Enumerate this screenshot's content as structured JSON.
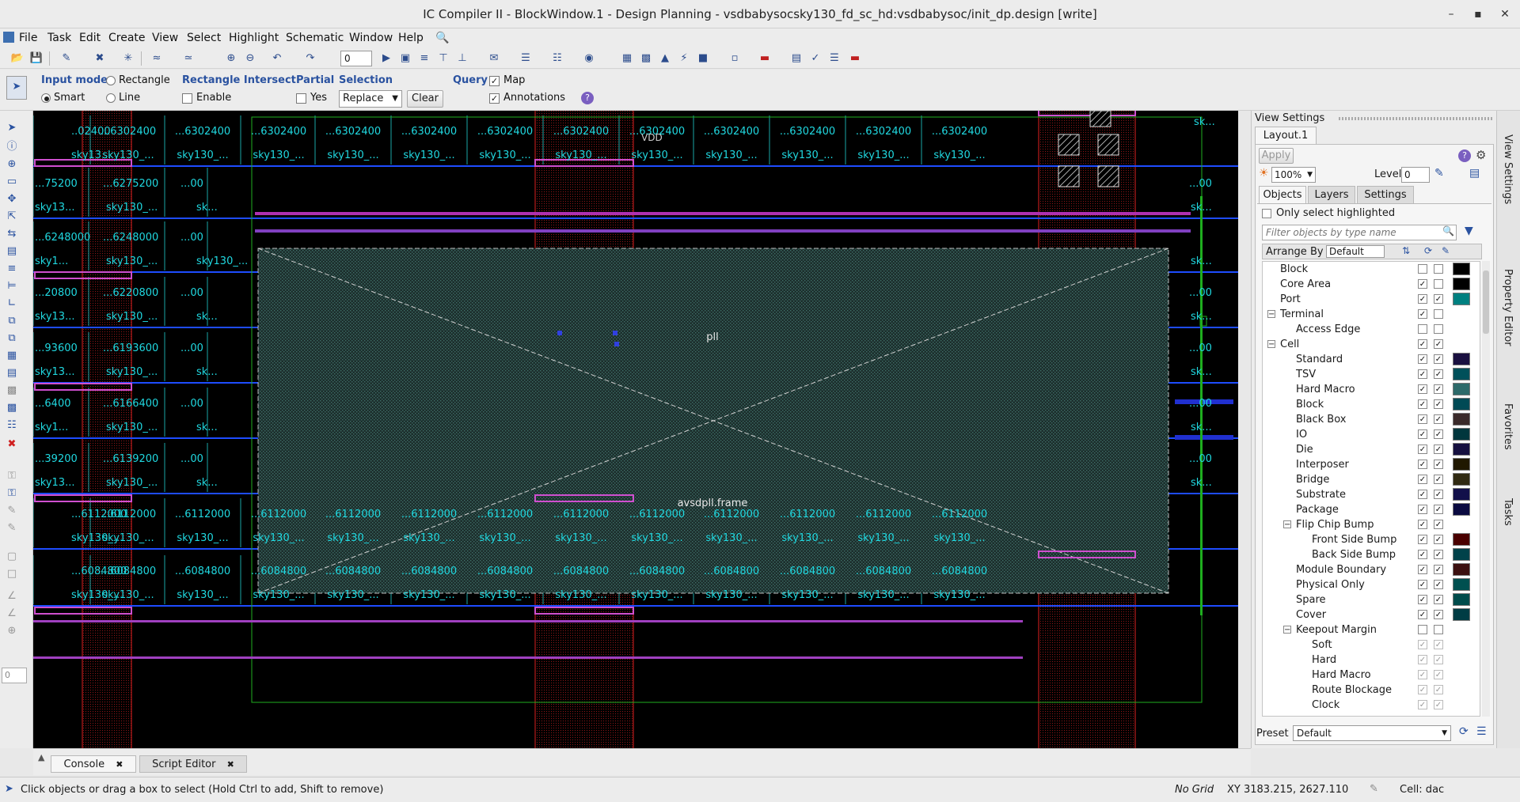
{
  "window": {
    "title": "IC Compiler II - BlockWindow.1 - Design Planning - vsdbabysocsky130_fd_sc_hd:vsdbabysoc/init_dp.design [write]",
    "minimize": "–",
    "maximize": "▪",
    "close": "✕"
  },
  "menubar": [
    "File",
    "Task",
    "Edit",
    "Create",
    "View",
    "Select",
    "Highlight",
    "Schematic",
    "Window",
    "Help"
  ],
  "toolbar": {
    "level_value": "0"
  },
  "select_options": {
    "input_mode_label": "Input mode",
    "rectangle_label": "Rectangle",
    "smart_label": "Smart",
    "line_label": "Line",
    "rect_intersect_label": "Rectangle Intersect",
    "enable_label": "Enable",
    "partial_label": "Partial",
    "yes_label": "Yes",
    "selection_label": "Selection",
    "replace_value": "Replace",
    "clear_label": "Clear",
    "query_label": "Query",
    "map_label": "Map",
    "annotations_label": "Annotations"
  },
  "canvas": {
    "macro_top_label": "pll",
    "macro_bottom_label": "avsdpll.frame",
    "vdd_label": "VDD",
    "rows": [
      {
        "coord": [
          "..02400",
          "...6302400",
          "...6302400",
          "...6302400",
          "...6302400",
          "...6302400",
          "...6302400",
          "...6302400",
          "...6302400",
          "...6302400",
          "...6302400",
          "...6302400",
          "...6302400"
        ],
        "cell": [
          "sky13...",
          "sky130_...",
          "sky130_...",
          "sky130_...",
          "sky130_...",
          "sky130_...",
          "sky130_...",
          "sky130_...",
          "sky130_...",
          "sky130_...",
          "sky130_...",
          "sky130_...",
          "sky130_..."
        ]
      },
      {
        "coord": [
          "...75200",
          "...6275200",
          "...00",
          "...00"
        ],
        "cell": [
          "sky13...",
          "sky130_...",
          "sk...",
          "sk..."
        ]
      },
      {
        "coord": [
          "...6248000",
          "...6248000",
          "...00"
        ],
        "cell": [
          "sky1...",
          "sky130_...",
          "sky130_...",
          "sk..."
        ]
      },
      {
        "coord": [
          "...20800",
          "...6220800",
          "...00",
          "...00"
        ],
        "cell": [
          "sky13...",
          "sky130_...",
          "sk...",
          "sk..."
        ]
      },
      {
        "coord": [
          "...93600",
          "...6193600",
          "...00",
          "...00"
        ],
        "cell": [
          "sky13...",
          "sky130_...",
          "sk...",
          "sk..."
        ]
      },
      {
        "coord": [
          "...6400",
          "...6166400",
          "...00",
          "...00"
        ],
        "cell": [
          "sky1...",
          "sky130_...",
          "sk...",
          "sk..."
        ]
      },
      {
        "coord": [
          "...39200",
          "...6139200",
          "...00",
          "...00"
        ],
        "cell": [
          "sky13...",
          "sky130_...",
          "sk...",
          "sk..."
        ]
      },
      {
        "coord": [
          "...6112000",
          "...6112000",
          "...6112000",
          "...6112000",
          "...6112000",
          "...6112000",
          "...6112000",
          "...6112000",
          "...6112000",
          "...6112000",
          "...6112000",
          "...6112000",
          "...6112000"
        ],
        "cell": [
          "sky130_...",
          "sky130_...",
          "sky130_...",
          "sky130_...",
          "sky130_...",
          "sky130_...",
          "sky130_...",
          "sky130_...",
          "sky130_...",
          "sky130_...",
          "sky130_...",
          "sky130_...",
          "sky130_..."
        ]
      },
      {
        "coord": [
          "...6084800",
          "...6084800",
          "...6084800",
          "...6084800",
          "...6084800",
          "...6084800",
          "...6084800",
          "...6084800",
          "...6084800",
          "...6084800",
          "...6084800",
          "...6084800",
          "...6084800"
        ],
        "cell": [
          "sky130_...",
          "sky130_...",
          "sky130_...",
          "sky130_...",
          "sky130_...",
          "sky130_...",
          "sky130_...",
          "sky130_...",
          "sky130_...",
          "sky130_...",
          "sky130_...",
          "sky130_...",
          "sky130_..."
        ]
      }
    ],
    "top_right_label": "sk..."
  },
  "view_settings": {
    "header": "View Settings",
    "layout_tab": "Layout.1",
    "apply_label": "Apply",
    "zoom_value": "100%",
    "level_label": "Level",
    "level_value": "0",
    "tabs": [
      "Objects",
      "Layers",
      "Settings"
    ],
    "only_select_label": "Only select highlighted",
    "filter_placeholder": "Filter objects by type name",
    "arrange_label": "Arrange By",
    "arrange_value": "Default",
    "preset_label": "Preset",
    "preset_value": "Default",
    "tree": [
      {
        "label": "Block",
        "indent": 0,
        "c1": "",
        "c2": "",
        "swatch": "#000000"
      },
      {
        "label": "Core Area",
        "indent": 0,
        "c1": "✓",
        "c2": "",
        "swatch": "#000000"
      },
      {
        "label": "Port",
        "indent": 0,
        "c1": "✓",
        "c2": "✓",
        "swatch": "#008080"
      },
      {
        "label": "Terminal",
        "indent": 0,
        "expander": "−",
        "c1": "✓",
        "c2": "",
        "swatch": ""
      },
      {
        "label": "Access Edge",
        "indent": 2,
        "c1": "",
        "c2": "-",
        "swatch": ""
      },
      {
        "label": "Cell",
        "indent": 0,
        "expander": "−",
        "c1": "✓",
        "c2": "✓",
        "swatch": ""
      },
      {
        "label": "Standard",
        "indent": 2,
        "c1": "✓",
        "c2": "✓",
        "swatch": "#1a1040"
      },
      {
        "label": "TSV",
        "indent": 2,
        "c1": "✓",
        "c2": "✓",
        "swatch": "#00505a"
      },
      {
        "label": "Hard Macro",
        "indent": 2,
        "c1": "✓",
        "c2": "✓",
        "swatch": "#2d6a6a"
      },
      {
        "label": "Block",
        "indent": 2,
        "c1": "✓",
        "c2": "✓",
        "swatch": "#004a55"
      },
      {
        "label": "Black Box",
        "indent": 2,
        "c1": "✓",
        "c2": "✓",
        "swatch": "#3a2a2a"
      },
      {
        "label": "IO",
        "indent": 2,
        "c1": "✓",
        "c2": "✓",
        "swatch": "#00363d"
      },
      {
        "label": "Die",
        "indent": 2,
        "c1": "✓",
        "c2": "✓",
        "swatch": "#161040"
      },
      {
        "label": "Interposer",
        "indent": 2,
        "c1": "✓",
        "c2": "✓",
        "swatch": "#201800"
      },
      {
        "label": "Bridge",
        "indent": 2,
        "c1": "✓",
        "c2": "✓",
        "swatch": "#302a12"
      },
      {
        "label": "Substrate",
        "indent": 2,
        "c1": "✓",
        "c2": "✓",
        "swatch": "#12104a"
      },
      {
        "label": "Package",
        "indent": 2,
        "c1": "✓",
        "c2": "✓",
        "swatch": "#0a0a40"
      },
      {
        "label": "Flip Chip Bump",
        "indent": 2,
        "expander": "−",
        "c1": "✓",
        "c2": "✓",
        "swatch": ""
      },
      {
        "label": "Front Side Bump",
        "indent": 4,
        "c1": "✓",
        "c2": "✓",
        "swatch": "#4a0000"
      },
      {
        "label": "Back Side Bump",
        "indent": 4,
        "c1": "✓",
        "c2": "✓",
        "swatch": "#00424a"
      },
      {
        "label": "Module Boundary",
        "indent": 2,
        "c1": "✓",
        "c2": "✓",
        "swatch": "#3c1010"
      },
      {
        "label": "Physical Only",
        "indent": 2,
        "c1": "✓",
        "c2": "✓",
        "swatch": "#005050"
      },
      {
        "label": "Spare",
        "indent": 2,
        "c1": "✓",
        "c2": "✓",
        "swatch": "#004c4c"
      },
      {
        "label": "Cover",
        "indent": 2,
        "c1": "✓",
        "c2": "✓",
        "swatch": "#003c44"
      },
      {
        "label": "Keepout Margin",
        "indent": 2,
        "expander": "−",
        "c1": "",
        "c2": "",
        "swatch": ""
      },
      {
        "label": "Soft",
        "indent": 4,
        "c1": "✓",
        "c2": "✓",
        "dim": true,
        "swatch": ""
      },
      {
        "label": "Hard",
        "indent": 4,
        "c1": "✓",
        "c2": "✓",
        "dim": true,
        "swatch": ""
      },
      {
        "label": "Hard Macro",
        "indent": 4,
        "c1": "✓",
        "c2": "✓",
        "dim": true,
        "swatch": ""
      },
      {
        "label": "Route Blockage",
        "indent": 4,
        "c1": "✓",
        "c2": "✓",
        "dim": true,
        "swatch": ""
      },
      {
        "label": "Clock",
        "indent": 4,
        "c1": "✓",
        "c2": "✓",
        "dim": true,
        "swatch": ""
      }
    ]
  },
  "side_tabs": [
    "View Settings",
    "Property Editor",
    "Favorites",
    "Tasks"
  ],
  "bottom_tabs": [
    "Console",
    "Script Editor"
  ],
  "left_level_value": "0",
  "status": {
    "hint": "Click objects or drag a box to select (Hold Ctrl to add, Shift to remove)",
    "grid": "No Grid",
    "xy": "XY 3183.215, 2627.110",
    "cell": "Cell: dac"
  }
}
